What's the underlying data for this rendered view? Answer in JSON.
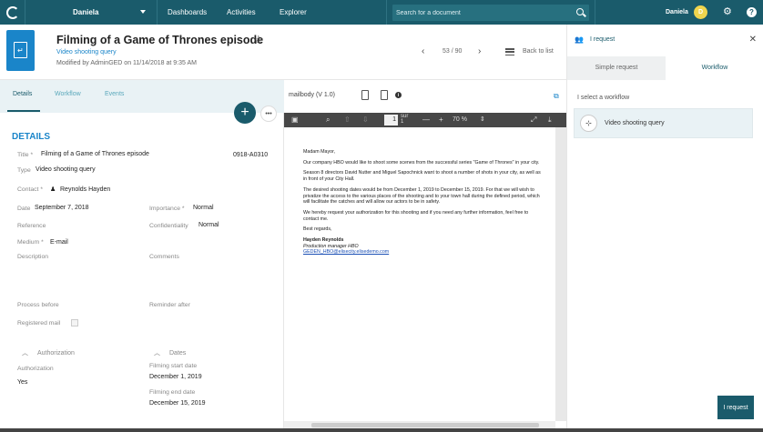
{
  "topbar": {
    "user_menu": "Daniela",
    "nav": [
      "Dashboards",
      "Activities",
      "Explorer"
    ],
    "search_placeholder": "Search for a document",
    "user_name": "Daniela",
    "avatar_initial": "D",
    "help": "?"
  },
  "header": {
    "title": "Filming of a Game of Thrones episode",
    "subtitle": "Video shooting query",
    "modified": "Modified by AdminGED on 11/14/2018 at 9:35 AM",
    "pager": "53 / 90",
    "back_label": "Back to list"
  },
  "left": {
    "tabs": [
      "Details",
      "Workflow",
      "Events"
    ],
    "section_title": "DETAILS",
    "title_label": "Title",
    "title_value": "Filming of a Game of Thrones episode",
    "ref_code": "0918-A0310",
    "type_label": "Type",
    "type_value": "Video shooting query",
    "contact_label": "Contact",
    "contact_value": "Reynolds Hayden",
    "date_label": "Date",
    "date_value": "September 7, 2018",
    "importance_label": "Importance",
    "importance_value": "Normal",
    "reference_label": "Reference",
    "confidentiality_label": "Confidentiality",
    "confidentiality_value": "Normal",
    "medium_label": "Medium",
    "medium_value": "E-mail",
    "description_label": "Description",
    "comments_label": "Comments",
    "process_before_label": "Process before",
    "reminder_after_label": "Reminder after",
    "registered_mail_label": "Registered mail",
    "authorization_section": "Authorization",
    "dates_section": "Dates",
    "authorization_label": "Authorization",
    "authorization_value": "Yes",
    "filming_start_label": "Filming start date",
    "filming_start_value": "December 1, 2019",
    "filming_end_label": "Filming end date",
    "filming_end_value": "December 15, 2019"
  },
  "viewer": {
    "file_label": "mailbody (V 1.0)",
    "page_number": "1",
    "page_of": "sur",
    "page_total": "1",
    "zoom": "70 %",
    "letter": {
      "greeting": "Madam Mayor,",
      "p1": "Our company HBO would like to shoot some scenes from the successful series \"Game of Thrones\" in your city.",
      "p2": "Season 8 directors David Nutter and Miguel Sapochnick want to shoot a number of shots in your city, as well as in front of your City Hall.",
      "p3": "The desired shooting dates would be from December 1, 2019 to December 15, 2019. For that we will wish to privatize the access to the various places of the shooting and to your town hall during the defined period, which will facilitate the catches and will allow our actors to be in safety.",
      "p4": "We hereby request your authorization for this shooting and if you need any further information, feel free to contact me.",
      "closing": "Best regards,",
      "signature_name": "Hayden Reynolds",
      "signature_role": "Production manager HBO",
      "signature_email": "GEDEN_HBO@elisecity.elisedemo.com"
    }
  },
  "right": {
    "title": "I request",
    "tabs": [
      "Simple request",
      "Workflow"
    ],
    "select_label": "I select a workflow",
    "workflow_item": "Video shooting query",
    "request_button": "I request"
  }
}
